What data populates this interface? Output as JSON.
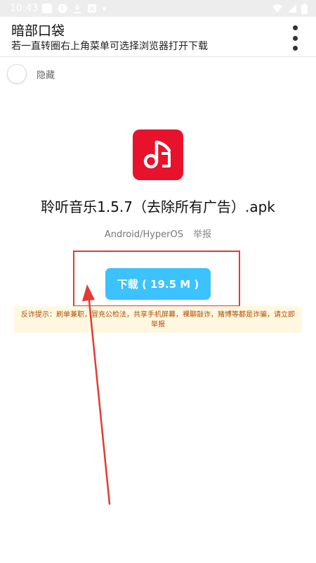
{
  "status_bar": {
    "time": "10:43"
  },
  "app_bar": {
    "title": "暗部口袋",
    "subtitle": "若一直转圈右上角菜单可选择浏览器打开下载",
    "menu_icon": "more-vertical-icon"
  },
  "hide_toggle": {
    "label": "隐藏"
  },
  "apk": {
    "icon": "music-note-icon",
    "icon_color": "#e8122c",
    "name": "聆听音乐1.5.7（去除所有广告）.apk",
    "platform": "Android/HyperOS",
    "report_label": "举报"
  },
  "download": {
    "label": "下载 ( 19.5 M )",
    "color": "#3cc2ff"
  },
  "warning": {
    "text": "反诈提示：刷单兼职，冒充公检法，共享手机屏幕，裸聊敲诈，赌博等都是诈骗，请立即举报"
  },
  "annotation": {
    "box_color": "#e53935",
    "arrow_color": "#e53935"
  }
}
